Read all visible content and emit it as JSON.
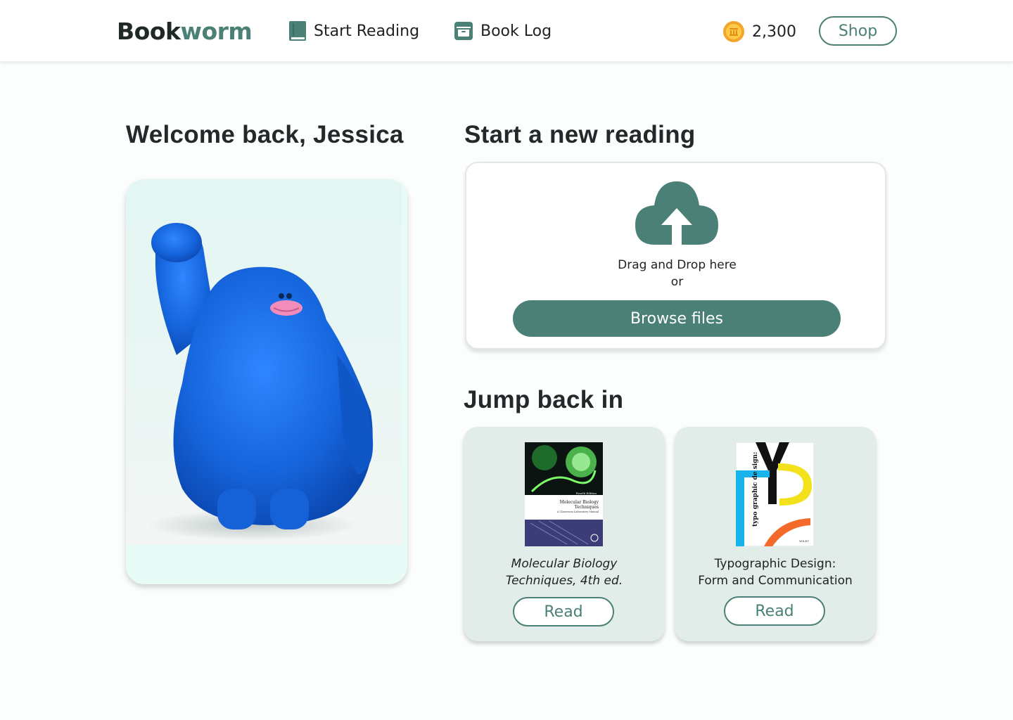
{
  "brand": {
    "logo_part1": "Book",
    "logo_part2": "worm",
    "accent_color": "#4a8075"
  },
  "nav": {
    "items": [
      {
        "label": "Start Reading",
        "icon": "book-icon"
      },
      {
        "label": "Book Log",
        "icon": "archive-box-icon"
      }
    ]
  },
  "account": {
    "coins": "2,300",
    "coin_icon": "coin-icon",
    "shop_label": "Shop"
  },
  "welcome": {
    "heading": "Welcome back, Jessica",
    "mascot": "blue furry monster waving"
  },
  "upload": {
    "heading": "Start a new reading",
    "icon": "cloud-upload-icon",
    "drag_text": "Drag and Drop here",
    "or_text": "or",
    "browse_label": "Browse files"
  },
  "jump_back": {
    "heading": "Jump back in",
    "books": [
      {
        "title_line1": "Molecular Biology",
        "title_line2": "Techniques, 4th ed.",
        "cover_edition": "Fourth Edition",
        "cover_title_line1": "Molecular Biology",
        "cover_title_line2": "Techniques",
        "cover_subtitle": "A Classroom Laboratory Manual",
        "read_label": "Read"
      },
      {
        "title_line1": "Typographic Design:",
        "title_line2": "Form and Communication",
        "cover_title": "typo graphic de sign:",
        "cover_publisher": "WILEY",
        "read_label": "Read"
      }
    ]
  }
}
